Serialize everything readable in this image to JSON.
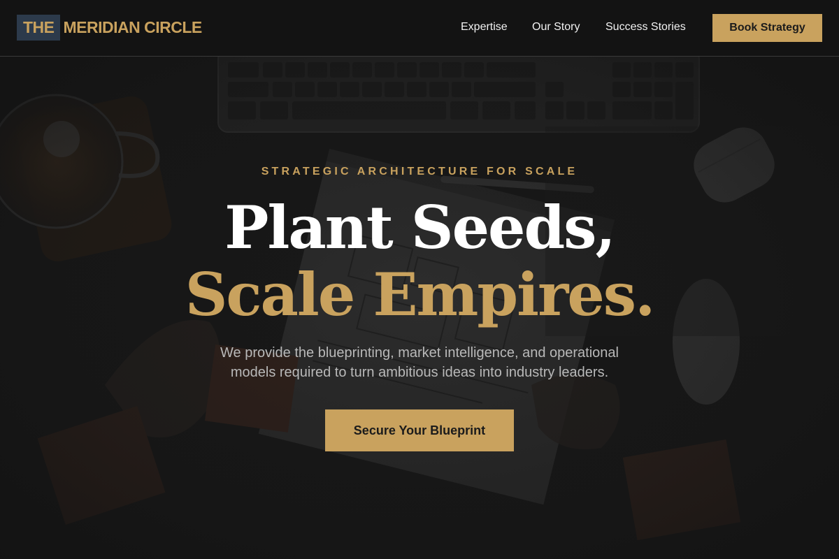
{
  "header": {
    "logo": {
      "prefix": "THE",
      "name": "MERIDIAN CIRCLE"
    },
    "nav": [
      {
        "label": "Expertise"
      },
      {
        "label": "Our Story"
      },
      {
        "label": "Success Stories"
      }
    ],
    "cta_label": "Book Strategy"
  },
  "hero": {
    "eyebrow": "STRATEGIC ARCHITECTURE FOR SCALE",
    "headline_line1": "Plant Seeds,",
    "headline_line2": "Scale Empires.",
    "subtitle_line1": "We provide the blueprinting, market intelligence, and operational",
    "subtitle_line2": "models required to turn ambitious ideas into industry leaders.",
    "cta_label": "Secure Your Blueprint",
    "background": "dark desk with keyboard, coffee glass, notebook, earbuds case and mouse"
  },
  "colors": {
    "accent_gold": "#c9a25e",
    "background": "#141414",
    "logo_box": "#2c3a4b",
    "text_light": "#f2f2f2",
    "text_muted": "#b9b9b9"
  }
}
